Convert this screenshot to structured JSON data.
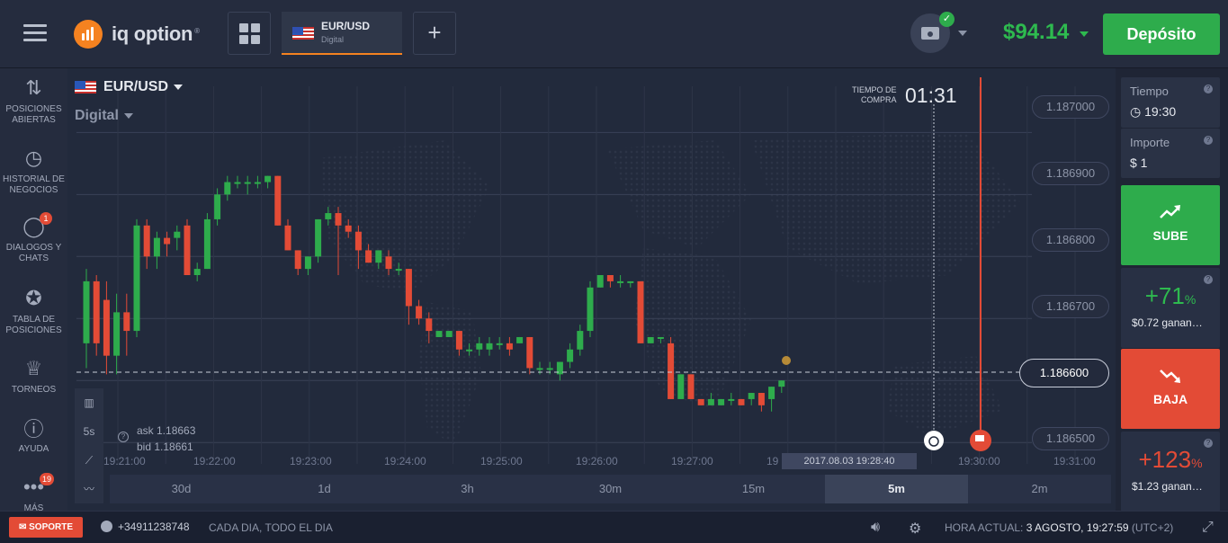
{
  "topbar": {
    "brand": "iq option",
    "asset_tab": {
      "name": "EUR/USD",
      "type": "Digital"
    },
    "add_label": "+",
    "balance": "$94.14",
    "deposit_label": "Depósito"
  },
  "sidebar": [
    {
      "icon": "swap-arrows-icon",
      "label": "POSICIONES ABIERTAS"
    },
    {
      "icon": "history-icon",
      "label": "HISTORIAL DE NEGOCIOS"
    },
    {
      "icon": "chat-icon",
      "label": "DIALOGOS Y CHATS",
      "badge": "1"
    },
    {
      "icon": "medal-icon",
      "label": "TABLA DE POSICIONES"
    },
    {
      "icon": "trophy-icon",
      "label": "TORNEOS"
    },
    {
      "icon": "help-icon",
      "label": "AYUDA"
    },
    {
      "icon": "more-icon",
      "label": "MÁS",
      "badge": "19"
    }
  ],
  "chart": {
    "asset": "EUR/USD",
    "mode": "Digital",
    "buy_time_label": "TIEMPO DE COMPRA",
    "buy_timer": "01:31",
    "price_labels": [
      "1.187000",
      "1.186900",
      "1.186800",
      "1.186700",
      "1.186600",
      "1.186500"
    ],
    "current_price": "1.186600",
    "ask": "ask 1.18663",
    "bid": "bid 1.18661",
    "tool_interval": "5s",
    "time_labels": [
      "19:21:00",
      "19:22:00",
      "19:23:00",
      "19:24:00",
      "19:25:00",
      "19:26:00",
      "19:27:00",
      "19",
      "19:30:00",
      "19:31:00"
    ],
    "date_tag": "2017.08.03 19:28:40",
    "timeframes": [
      "30d",
      "1d",
      "3h",
      "30m",
      "15m",
      "5m",
      "2m"
    ],
    "active_timeframe": "5m"
  },
  "chart_data": {
    "type": "candlestick",
    "ylim": [
      1.18648,
      1.18706
    ],
    "candles": [
      [
        1.18666,
        1.18678,
        1.18662,
        1.18676
      ],
      [
        1.18676,
        1.18677,
        1.18664,
        1.18666
      ],
      [
        1.18673,
        1.18676,
        1.18661,
        1.18664
      ],
      [
        1.18664,
        1.18674,
        1.18661,
        1.18671
      ],
      [
        1.18671,
        1.18674,
        1.18664,
        1.18668
      ],
      [
        1.18668,
        1.18686,
        1.18667,
        1.18685
      ],
      [
        1.18685,
        1.18686,
        1.18678,
        1.1868
      ],
      [
        1.1868,
        1.18684,
        1.18678,
        1.18683
      ],
      [
        1.18683,
        1.18684,
        1.1868,
        1.18682
      ],
      [
        1.18683,
        1.18685,
        1.18681,
        1.18684
      ],
      [
        1.18685,
        1.18686,
        1.18677,
        1.18677
      ],
      [
        1.18677,
        1.18679,
        1.18676,
        1.18678
      ],
      [
        1.18678,
        1.18687,
        1.18678,
        1.18686
      ],
      [
        1.18686,
        1.18691,
        1.18685,
        1.1869
      ],
      [
        1.1869,
        1.18693,
        1.18689,
        1.18692
      ],
      [
        1.18692,
        1.18693,
        1.18691,
        1.18692
      ],
      [
        1.18692,
        1.18693,
        1.1869,
        1.18692
      ],
      [
        1.18692,
        1.18693,
        1.18691,
        1.18692
      ],
      [
        1.18692,
        1.18693,
        1.18691,
        1.18693
      ],
      [
        1.18693,
        1.18693,
        1.18685,
        1.18685
      ],
      [
        1.18685,
        1.18686,
        1.18681,
        1.18681
      ],
      [
        1.18681,
        1.18681,
        1.18677,
        1.18678
      ],
      [
        1.18678,
        1.1868,
        1.18677,
        1.1868
      ],
      [
        1.1868,
        1.18686,
        1.18679,
        1.18686
      ],
      [
        1.18686,
        1.18688,
        1.18685,
        1.18687
      ],
      [
        1.18687,
        1.18688,
        1.18677,
        1.18685
      ],
      [
        1.18685,
        1.18686,
        1.18683,
        1.18684
      ],
      [
        1.18684,
        1.18685,
        1.18678,
        1.18681
      ],
      [
        1.18681,
        1.18682,
        1.18679,
        1.18679
      ],
      [
        1.18679,
        1.18681,
        1.18678,
        1.18681
      ],
      [
        1.1868,
        1.18681,
        1.18677,
        1.18678
      ],
      [
        1.18678,
        1.18679,
        1.18677,
        1.18678
      ],
      [
        1.18678,
        1.18678,
        1.18669,
        1.18672
      ],
      [
        1.18672,
        1.18673,
        1.18669,
        1.1867
      ],
      [
        1.1867,
        1.18671,
        1.18666,
        1.18668
      ],
      [
        1.18667,
        1.18668,
        1.18667,
        1.18668
      ],
      [
        1.18667,
        1.18668,
        1.18667,
        1.18668
      ],
      [
        1.18668,
        1.18668,
        1.18664,
        1.18665
      ],
      [
        1.18665,
        1.18666,
        1.18664,
        1.18665
      ],
      [
        1.18665,
        1.18667,
        1.18664,
        1.18666
      ],
      [
        1.18665,
        1.18667,
        1.18664,
        1.18666
      ],
      [
        1.18666,
        1.18667,
        1.18665,
        1.18666
      ],
      [
        1.18666,
        1.18667,
        1.18664,
        1.18665
      ],
      [
        1.18666,
        1.18667,
        1.18666,
        1.18667
      ],
      [
        1.18667,
        1.18667,
        1.18661,
        1.18662
      ],
      [
        1.18662,
        1.18663,
        1.18661,
        1.18662
      ],
      [
        1.18662,
        1.18663,
        1.18661,
        1.18662
      ],
      [
        1.18661,
        1.18663,
        1.1866,
        1.18663
      ],
      [
        1.18663,
        1.18666,
        1.18662,
        1.18665
      ],
      [
        1.18665,
        1.18669,
        1.18664,
        1.18668
      ],
      [
        1.18668,
        1.18676,
        1.18667,
        1.18675
      ],
      [
        1.18675,
        1.18677,
        1.18675,
        1.18677
      ],
      [
        1.18677,
        1.18677,
        1.18675,
        1.18676
      ],
      [
        1.18676,
        1.18677,
        1.18675,
        1.18676
      ],
      [
        1.18676,
        1.18676,
        1.18675,
        1.18676
      ],
      [
        1.18676,
        1.18676,
        1.18666,
        1.18666
      ],
      [
        1.18666,
        1.18667,
        1.18666,
        1.18667
      ],
      [
        1.18667,
        1.18667,
        1.18666,
        1.18667
      ],
      [
        1.18666,
        1.18667,
        1.18657,
        1.18657
      ],
      [
        1.18657,
        1.18661,
        1.18657,
        1.18661
      ],
      [
        1.18661,
        1.18661,
        1.18657,
        1.18657
      ],
      [
        1.18657,
        1.18657,
        1.18656,
        1.18656
      ],
      [
        1.18656,
        1.18658,
        1.18656,
        1.18657
      ],
      [
        1.18656,
        1.18657,
        1.18656,
        1.18657
      ],
      [
        1.18657,
        1.18658,
        1.18656,
        1.18657
      ],
      [
        1.18657,
        1.18657,
        1.18656,
        1.18656
      ],
      [
        1.18657,
        1.18658,
        1.18656,
        1.18658
      ],
      [
        1.18658,
        1.18658,
        1.18655,
        1.18656
      ],
      [
        1.18657,
        1.18659,
        1.18655,
        1.18659
      ],
      [
        1.18659,
        1.1866,
        1.18658,
        1.1866
      ]
    ]
  },
  "right_panel": {
    "time_label": "Tiempo",
    "time_value": "19:30",
    "amount_label": "Importe",
    "amount_value": "$ 1",
    "call_label": "SUBE",
    "call_percent": "+71",
    "call_pct_sign": "%",
    "call_gain": "$0.72  ganan…",
    "put_label": "BAJA",
    "put_percent": "+123",
    "put_pct_sign": "%",
    "put_gain": "$1.23  ganan…",
    "colors": {
      "up": "#2eac4c",
      "down": "#e34b36"
    }
  },
  "footer": {
    "support_label": "SOPORTE",
    "phone": "+34911238748",
    "schedule": "CADA DIA, TODO EL DIA",
    "time_label": "HORA ACTUAL:",
    "time_value": "3 AGOSTO, 19:27:59",
    "tz": "(UTC+2)"
  }
}
